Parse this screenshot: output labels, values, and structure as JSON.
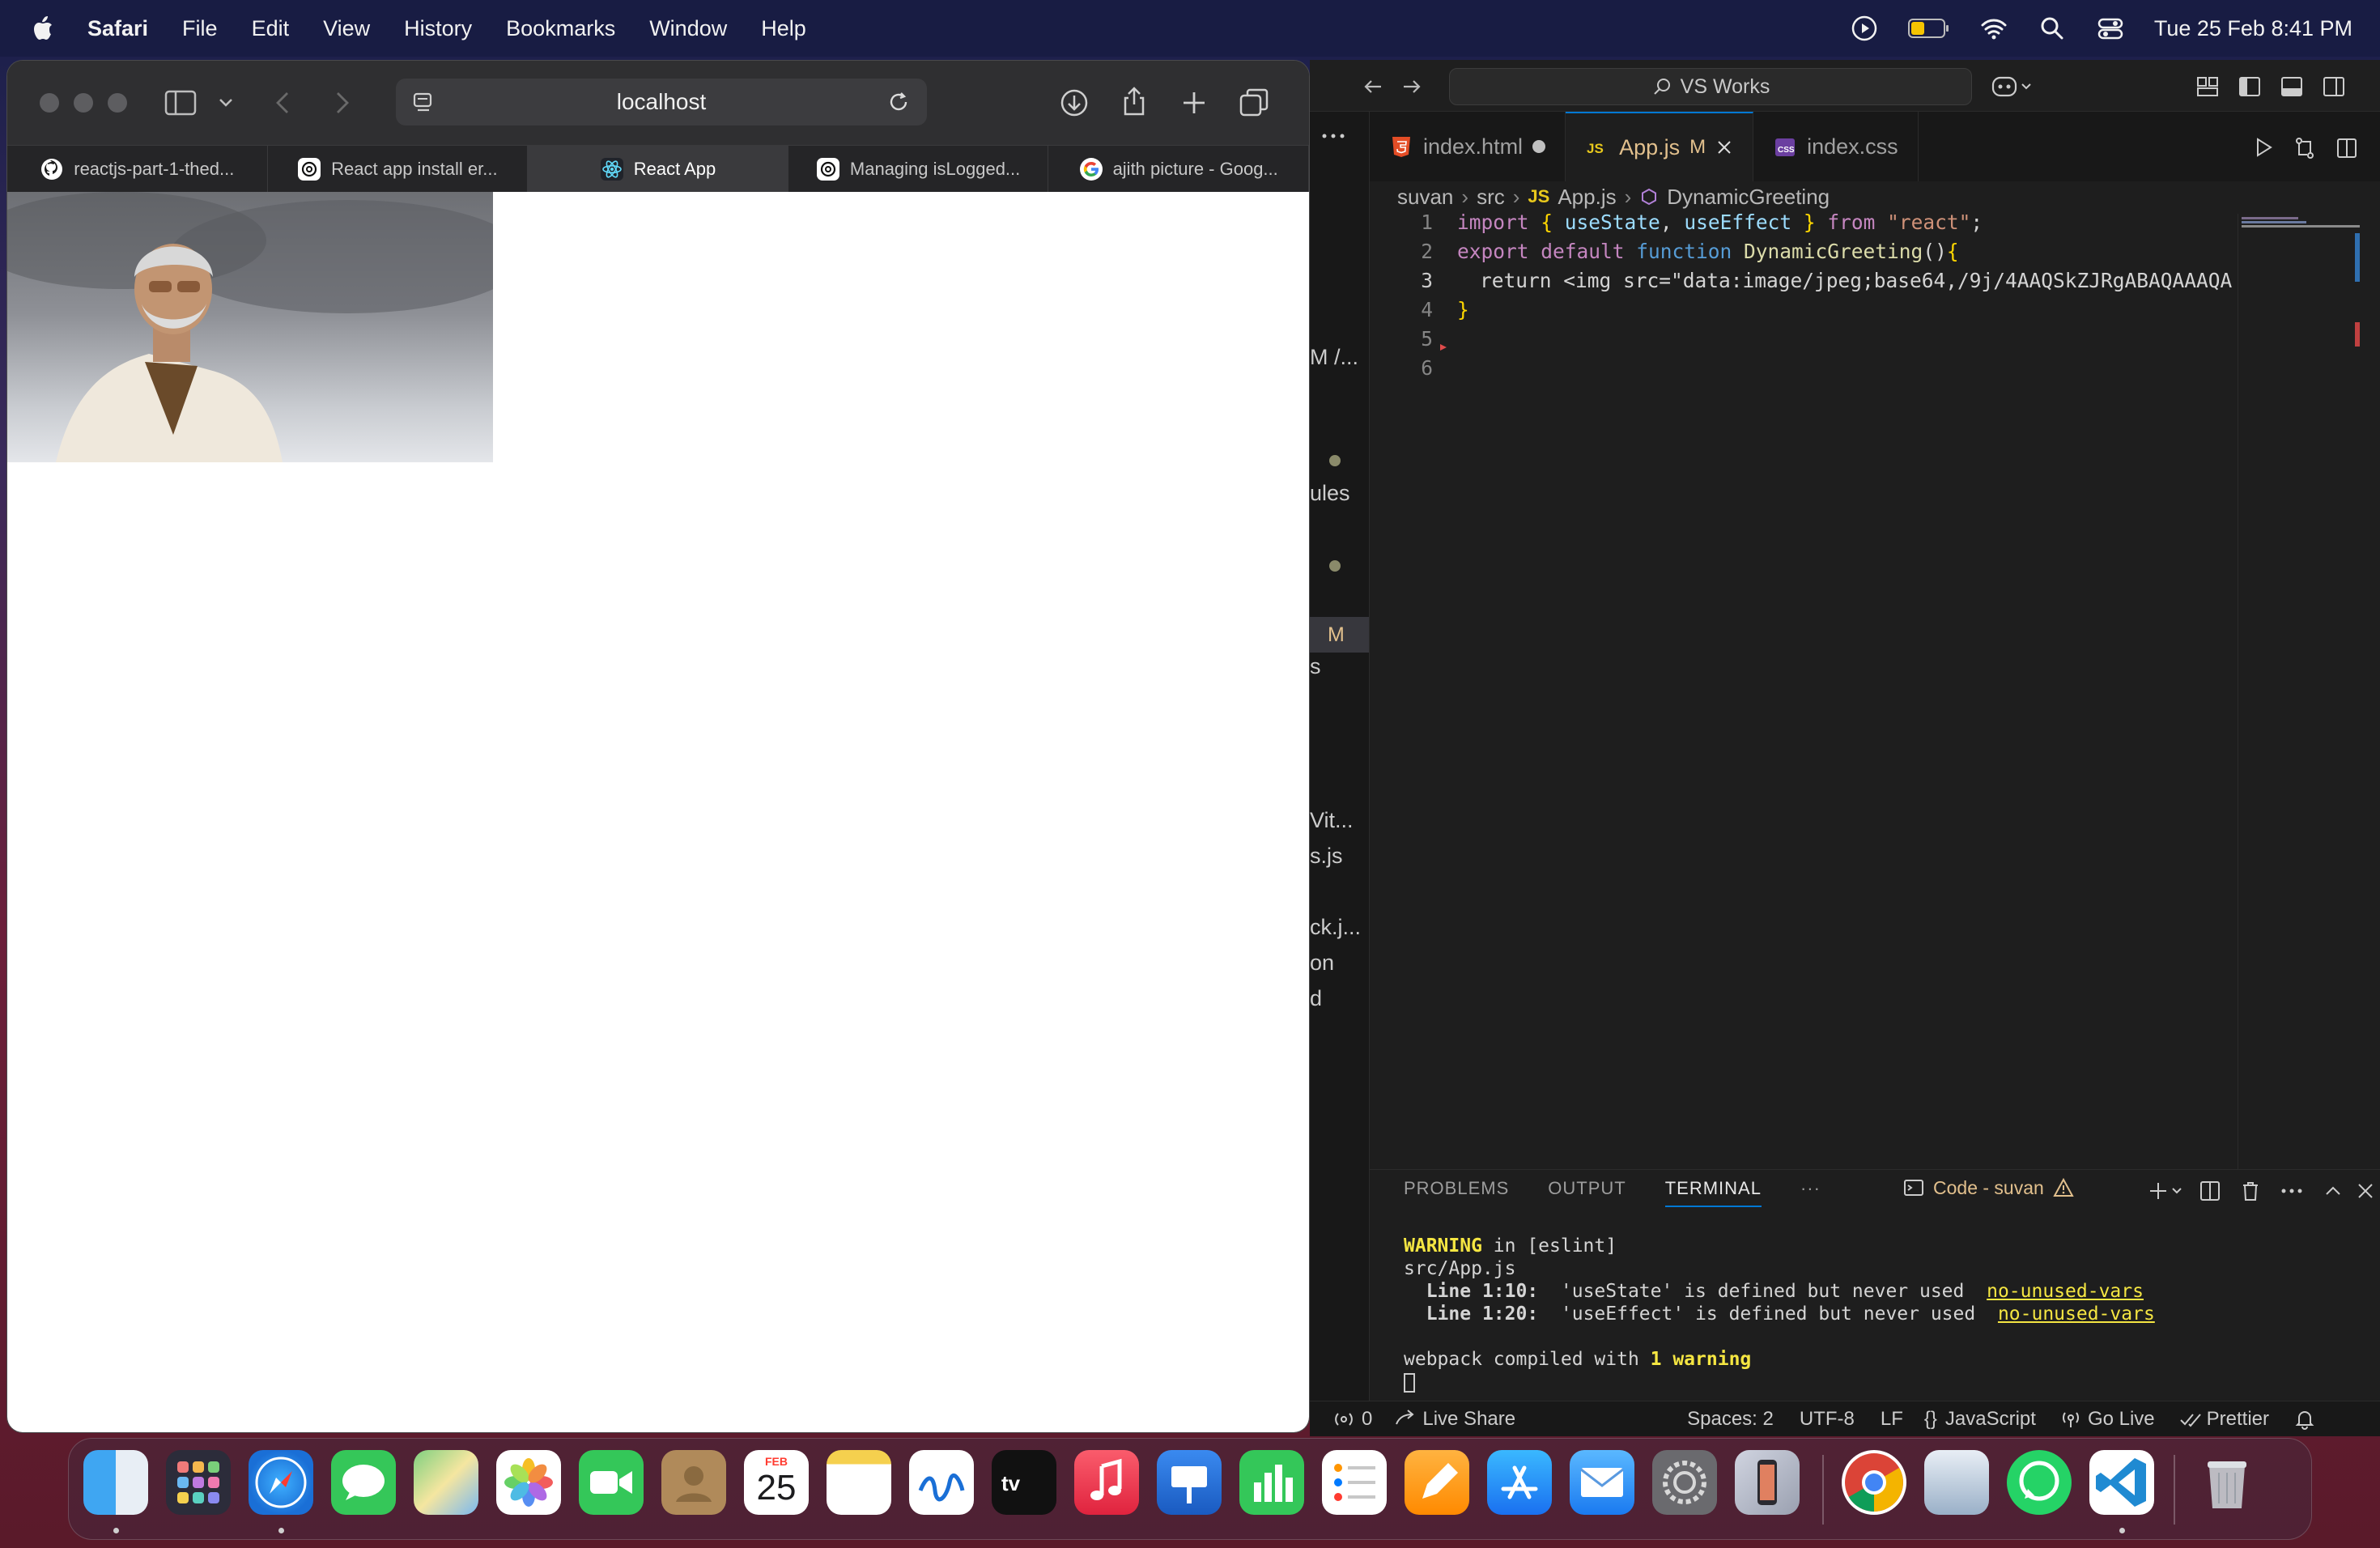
{
  "menubar": {
    "app_name": "Safari",
    "items": [
      "File",
      "Edit",
      "View",
      "History",
      "Bookmarks",
      "Window",
      "Help"
    ],
    "clock": "Tue 25 Feb  8:41 PM",
    "status_icons": [
      "now-playing-icon",
      "battery-icon",
      "wifi-icon",
      "spotlight-icon",
      "control-center-icon"
    ]
  },
  "safari": {
    "url": "localhost",
    "tabs": [
      {
        "label": "reactjs-part-1-thed...",
        "icon": "github-icon"
      },
      {
        "label": "React app install er...",
        "icon": "chatgpt-icon"
      },
      {
        "label": "React App",
        "icon": "react-icon",
        "active": true
      },
      {
        "label": "Managing isLogged...",
        "icon": "chatgpt-icon"
      },
      {
        "label": "ajith picture - Goog...",
        "icon": "google-icon"
      }
    ]
  },
  "vscode": {
    "command_center": "VS Works",
    "sidebar_fragments": [
      "M /...",
      "ules",
      "s",
      "Vit...",
      "s.js",
      "ck.j...",
      "on",
      "d"
    ],
    "sidebar_badge": "M",
    "tabs": [
      {
        "label": "index.html",
        "icon": "html-icon",
        "state": "unsaved"
      },
      {
        "label": "App.js",
        "icon": "js-icon",
        "badge": "M",
        "active": true
      },
      {
        "label": "index.css",
        "icon": "css-icon"
      }
    ],
    "breadcrumb": [
      "suvan",
      "src",
      "App.js",
      "DynamicGreeting"
    ],
    "line_numbers": [
      "1",
      "2",
      "3",
      "4",
      "5",
      "6"
    ],
    "code": {
      "l1_import": "import",
      "l1_open": "{",
      "l1_a": " useState",
      "l1_comma": ",",
      "l1_b": " useEffect",
      "l1_close": " }",
      "l1_from": " from",
      "l1_str": " \"react\"",
      "l1_semi": ";",
      "l2_export": "export",
      "l2_default": " default",
      "l2_function": " function",
      "l2_name": " DynamicGreeting",
      "l2_paren": "()",
      "l2_brace": "{",
      "l3_text": "return <img src=\"data:image/jpeg;base64,/9j/4AAQSkZJRgABAQAAAQA",
      "l4_brace": "}"
    },
    "panel_tabs": [
      "PROBLEMS",
      "OUTPUT",
      "TERMINAL"
    ],
    "panel_active": "TERMINAL",
    "terminal_name": "Code - suvan",
    "terminal": {
      "warning_word": "WARNING",
      "warning_rest": " in [eslint]",
      "file": "src/App.js",
      "line1_loc": "Line 1:10:",
      "line1_msg": "  'useState' is defined but never used",
      "line1_rule": "no-unused-vars",
      "line2_loc": "Line 1:20:",
      "line2_msg": "  'useEffect' is defined but never used",
      "line2_rule": "no-unused-vars",
      "compiled_pre": "webpack compiled with ",
      "compiled_count": "1 warning"
    },
    "statusbar": {
      "ports": "0",
      "live_share": "Live Share",
      "spaces": "Spaces: 2",
      "encoding": "UTF-8",
      "eol": "LF",
      "language": "JavaScript",
      "go_live": "Go Live",
      "prettier": "Prettier"
    }
  },
  "dock": {
    "calendar_month": "FEB",
    "calendar_day": "25",
    "apps": [
      "Finder",
      "Launchpad",
      "Safari",
      "Messages",
      "Maps",
      "Photos",
      "FaceTime",
      "Contacts",
      "Calendar",
      "Notes",
      "Freeform",
      "TV",
      "Music",
      "Keynote",
      "Numbers",
      "Reminders",
      "Pages",
      "App Store",
      "Mail",
      "System Settings",
      "iPhone Mirroring",
      "Chrome",
      "Preview",
      "WhatsApp",
      "Visual Studio Code",
      "Trash"
    ]
  },
  "colors": {
    "vscode_bg": "#1e1e1e",
    "accent": "#0078d4",
    "modified": "#e2c08d",
    "warning": "#f5e642"
  }
}
